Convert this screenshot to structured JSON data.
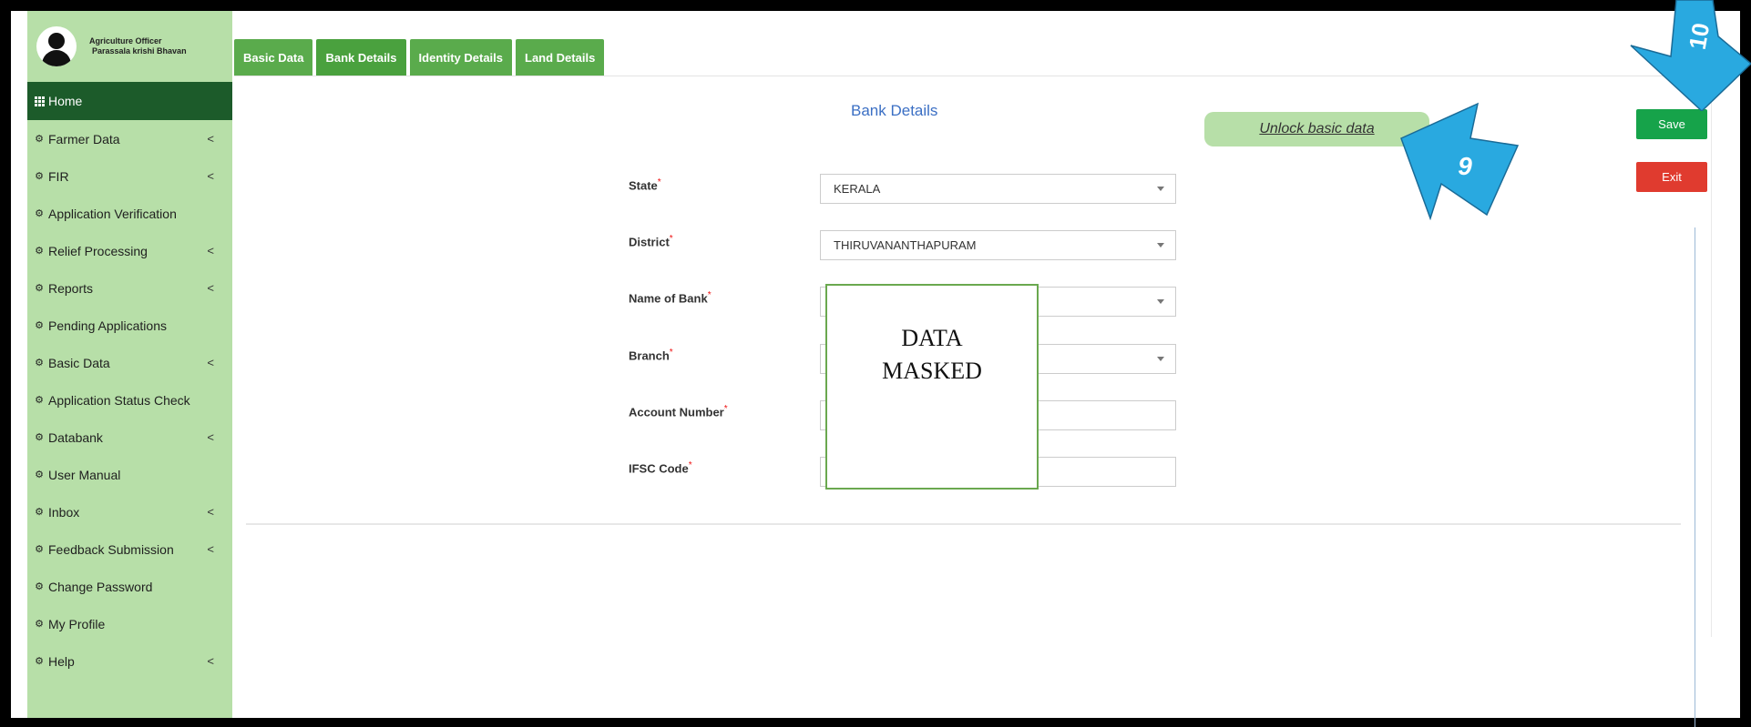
{
  "user": {
    "role": "Agriculture Officer",
    "office": "Parassala krishi Bhavan"
  },
  "sidebar": {
    "items": [
      {
        "label": "Home",
        "icon": "grid-icon",
        "has_submenu": false
      },
      {
        "label": "Farmer Data",
        "icon": "dashboard-icon",
        "has_submenu": true
      },
      {
        "label": "FIR",
        "icon": "dashboard-icon",
        "has_submenu": true
      },
      {
        "label": "Application Verification",
        "icon": "dashboard-icon",
        "has_submenu": false
      },
      {
        "label": "Relief Processing",
        "icon": "dashboard-icon",
        "has_submenu": true
      },
      {
        "label": "Reports",
        "icon": "dashboard-icon",
        "has_submenu": true
      },
      {
        "label": "Pending Applications",
        "icon": "dashboard-icon",
        "has_submenu": false
      },
      {
        "label": "Basic Data",
        "icon": "dashboard-icon",
        "has_submenu": true
      },
      {
        "label": "Application Status Check",
        "icon": "dashboard-icon",
        "has_submenu": false
      },
      {
        "label": "Databank",
        "icon": "dashboard-icon",
        "has_submenu": true
      },
      {
        "label": "User Manual",
        "icon": "dashboard-icon",
        "has_submenu": false
      },
      {
        "label": "Inbox",
        "icon": "dashboard-icon",
        "has_submenu": true
      },
      {
        "label": "Feedback Submission",
        "icon": "dashboard-icon",
        "has_submenu": true
      },
      {
        "label": "Change Password",
        "icon": "dashboard-icon",
        "has_submenu": false
      },
      {
        "label": "My Profile",
        "icon": "dashboard-icon",
        "has_submenu": false
      },
      {
        "label": "Help",
        "icon": "dashboard-icon",
        "has_submenu": true
      }
    ],
    "chevron": "<"
  },
  "tabs": [
    {
      "label": "Basic Data"
    },
    {
      "label": "Bank Details"
    },
    {
      "label": "Identity Details"
    },
    {
      "label": "Land Details"
    }
  ],
  "panel": {
    "title": "Bank Details",
    "unlock_label": "Unlock basic data",
    "required_mark": "*",
    "fields": [
      {
        "label": "State",
        "value": "KERALA",
        "type": "select"
      },
      {
        "label": "District",
        "value": "THIRUVANANTHAPURAM",
        "type": "select"
      },
      {
        "label": "Name of Bank",
        "value": "",
        "type": "select"
      },
      {
        "label": "Branch",
        "value": "",
        "type": "select"
      },
      {
        "label": "Account Number",
        "value": "",
        "type": "text"
      },
      {
        "label": "IFSC Code",
        "value": "",
        "type": "text"
      }
    ],
    "mask_line1": "DATA",
    "mask_line2": "MASKED"
  },
  "actions": {
    "save_label": "Save",
    "exit_label": "Exit"
  },
  "callouts": {
    "step9": "9",
    "step10": "10"
  },
  "colors": {
    "sidebar_bg": "#b7dfa8",
    "home_active": "#1c5b2a",
    "tab_bg": "#5aab4c",
    "save": "#16a34a",
    "exit": "#e03b2f",
    "title": "#3b6fc4",
    "callout": "#29a9e0"
  }
}
